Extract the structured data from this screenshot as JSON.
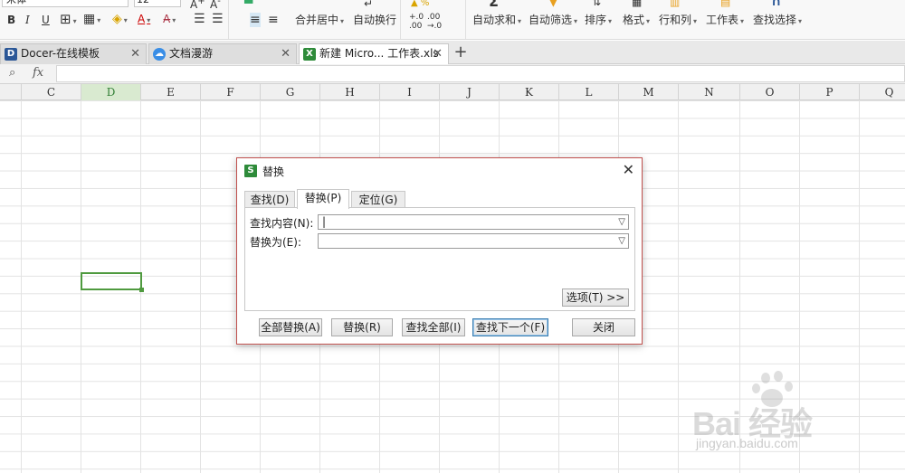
{
  "ribbon": {
    "font_name": "宋体",
    "font_size": "12",
    "bold": "B",
    "italic": "I",
    "underline": "U",
    "font_color_letter": "A",
    "merge_center": "合并居中",
    "auto_wrap": "自动换行",
    "auto_sum": "自动求和",
    "auto_filter": "自动筛选",
    "sort": "排序",
    "format": "格式",
    "rows_cols": "行和列",
    "worksheet": "工作表",
    "find_select": "查找选择"
  },
  "tabs": [
    {
      "label": "Docer-在线模板",
      "icon": "D",
      "color": "#2b5797"
    },
    {
      "label": "文档漫游",
      "icon": "☁",
      "color": "#3a8ee6"
    },
    {
      "label": "新建 Micro... 工作表.xls",
      "icon": "X",
      "color": "#2e8b3a"
    }
  ],
  "formula_bar": {
    "zoom_icon": "magnifier-icon",
    "fx": "fx",
    "value": ""
  },
  "columns": [
    "C",
    "D",
    "E",
    "F",
    "G",
    "H",
    "I",
    "J",
    "K",
    "L",
    "M",
    "N",
    "O",
    "P",
    "Q"
  ],
  "selected_column": "D",
  "dialog": {
    "title": "替换",
    "logo": "S",
    "close": "✕",
    "tabs": [
      "查找(D)",
      "替换(P)",
      "定位(G)"
    ],
    "active_tab": "替换(P)",
    "find_label": "查找内容(N):",
    "find_value": "|",
    "replace_label": "替换为(E):",
    "replace_value": "",
    "options_button": "选项(T) >>",
    "buttons": {
      "replace_all": "全部替换(A)",
      "replace": "替换(R)",
      "find_all": "查找全部(I)",
      "find_next": "查找下一个(F)",
      "close": "关闭"
    }
  },
  "watermark": {
    "logo": "Bai 经验",
    "url": "jingyan.baidu.com"
  }
}
